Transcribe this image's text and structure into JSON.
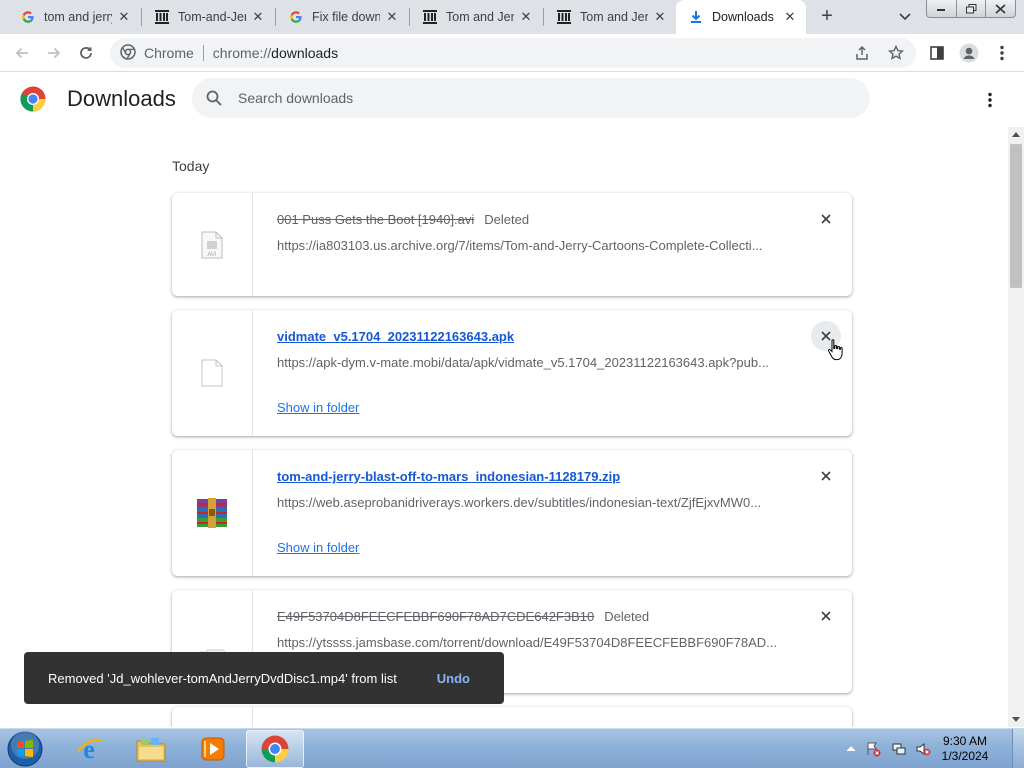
{
  "browser": {
    "tabs": [
      {
        "title": "tom and jerry",
        "favicon": "google-g-icon",
        "active": false
      },
      {
        "title": "Tom-and-Jerry",
        "favicon": "archive-icon",
        "active": false
      },
      {
        "title": "Fix file down",
        "favicon": "google-g-icon",
        "active": false
      },
      {
        "title": "Tom and Jerry",
        "favicon": "archive-icon",
        "active": false
      },
      {
        "title": "Tom and Jerry",
        "favicon": "archive-icon",
        "active": false
      },
      {
        "title": "Downloads",
        "favicon": "download-icon",
        "active": true
      }
    ],
    "omnibox": {
      "scheme_label": "Chrome",
      "url_prefix": "chrome://",
      "url_host": "downloads"
    }
  },
  "downloads": {
    "title": "Downloads",
    "search_placeholder": "Search downloads",
    "date_group": "Today",
    "items": [
      {
        "filename": "001 Puss Gets the Boot [1940].avi",
        "status": "Deleted",
        "url": "https://ia803103.us.archive.org/7/items/Tom-and-Jerry-Cartoons-Complete-Collecti...",
        "file_icon": "avi-file-icon",
        "deleted": true
      },
      {
        "filename": "vidmate_v5.1704_20231122163643.apk",
        "status": "",
        "url": "https://apk-dym.v-mate.mobi/data/apk/vidmate_v5.1704_20231122163643.apk?pub...",
        "action": "Show in folder",
        "file_icon": "blank-file-icon",
        "deleted": false
      },
      {
        "filename": "tom-and-jerry-blast-off-to-mars_indonesian-1128179.zip",
        "status": "",
        "url": "https://web.aseprobanidriverays.workers.dev/subtitles/indonesian-text/ZjfEjxvMW0...",
        "action": "Show in folder",
        "file_icon": "winrar-archive-icon",
        "deleted": false
      },
      {
        "filename": "E49F53704D8FEECFEBBF690F78AD7CDE642F3B10",
        "status": "Deleted",
        "url": "https://ytssss.jamsbase.com/torrent/download/E49F53704D8FEECFEBBF690F78AD...",
        "file_icon": "torrent-file-icon",
        "deleted": true
      }
    ]
  },
  "toast": {
    "message": "Removed 'Jd_wohlever-tomAndJerryDvdDisc1.mp4' from list",
    "action": "Undo"
  },
  "taskbar": {
    "apps": [
      "internet-explorer-icon",
      "file-explorer-icon",
      "media-player-icon",
      "chrome-icon"
    ],
    "clock_time": "9:30 AM",
    "clock_date": "1/3/2024"
  },
  "colors": {
    "tabstrip": "#dee1e6",
    "link": "#1a73e8",
    "toast_bg": "#323232",
    "undo": "#8ab4f8",
    "taskbar": "#8eb1d8"
  }
}
